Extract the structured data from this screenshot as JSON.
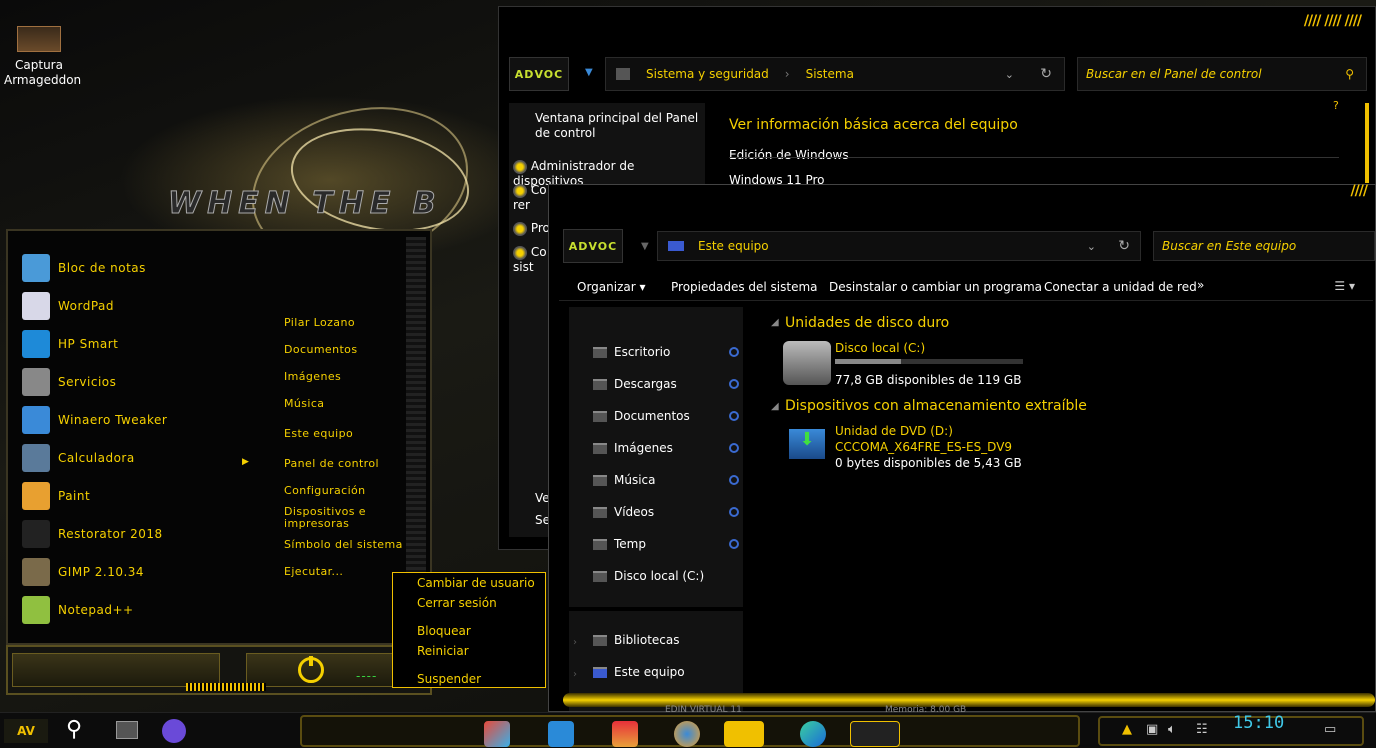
{
  "desktop": {
    "icon_label": "Captura Armageddon",
    "wallpaper_text": "WHEN THE B"
  },
  "start_menu": {
    "apps": [
      {
        "label": "Bloc de notas",
        "icon": "notepad-icon",
        "color": "#4a9ad8"
      },
      {
        "label": "WordPad",
        "icon": "wordpad-icon",
        "color": "#d8d8e8"
      },
      {
        "label": "HP Smart",
        "icon": "hp-smart-icon",
        "color": "#1e8ad8"
      },
      {
        "label": "Servicios",
        "icon": "gear-icon",
        "color": "#888888"
      },
      {
        "label": "Winaero Tweaker",
        "icon": "winaero-icon",
        "color": "#3a8ad8"
      },
      {
        "label": "Calculadora",
        "icon": "calculator-icon",
        "color": "#5a7a9a"
      },
      {
        "label": "Paint",
        "icon": "paint-icon",
        "color": "#e8a030"
      },
      {
        "label": "Restorator 2018",
        "icon": "restorator-icon",
        "color": "#222222"
      },
      {
        "label": "GIMP 2.10.34",
        "icon": "gimp-icon",
        "color": "#7a6a4a"
      },
      {
        "label": "Notepad++",
        "icon": "notepadpp-icon",
        "color": "#90c040"
      }
    ],
    "places": [
      "Pilar Lozano",
      "Documentos",
      "Imágenes",
      "Música",
      "Este equipo",
      "Panel de control",
      "Configuración",
      "Dispositivos e impresoras",
      "Símbolo del sistema",
      "Ejecutar..."
    ],
    "power_dashes": "----",
    "power_menu": [
      "Cambiar de usuario",
      "Cerrar sesión",
      "Bloquear",
      "Reiniciar",
      "Suspender"
    ]
  },
  "control_panel": {
    "logo": "ADVOC",
    "breadcrumb": [
      "Sistema y seguridad",
      "Sistema"
    ],
    "search_placeholder": "Buscar en el Panel de control",
    "help": "?",
    "nav": [
      "Ventana principal del Panel de control",
      "Administrador de dispositivos",
      "Co rer",
      "Pro",
      "Co sist",
      "Vea",
      "Seg"
    ],
    "heading": "Ver información básica acerca del equipo",
    "edition_label": "Edición de Windows",
    "edition_value": "Windows 11 Pro"
  },
  "explorer": {
    "logo": "ADVOC",
    "address": "Este equipo",
    "search_placeholder": "Buscar en Este equipo",
    "toolbar": [
      "Organizar",
      "Propiedades del sistema",
      "Desinstalar o cambiar un programa",
      "Conectar a unidad de red",
      "»"
    ],
    "nav": [
      "Escritorio",
      "Descargas",
      "Documentos",
      "Imágenes",
      "Música",
      "Vídeos",
      "Temp",
      "Disco local (C:)",
      "Bibliotecas",
      "Este equipo"
    ],
    "sections": {
      "hdd": "Unidades de disco duro",
      "removable": "Dispositivos con almacenamiento extraíble"
    },
    "drive_c": {
      "name": "Disco local (C:)",
      "space": "77,8 GB disponibles de 119 GB",
      "used_fraction": 0.35
    },
    "dvd": {
      "name": "Unidad de DVD (D:)",
      "label": "CCCOMA_X64FRE_ES-ES_DV9",
      "space": "0 bytes disponibles de 5,43 GB"
    },
    "status_left": "EDIN VIRTUAL 11",
    "status_right": "Memoria: 8,00 GB"
  },
  "taskbar": {
    "start_label": "AV",
    "clock": "15:10"
  }
}
